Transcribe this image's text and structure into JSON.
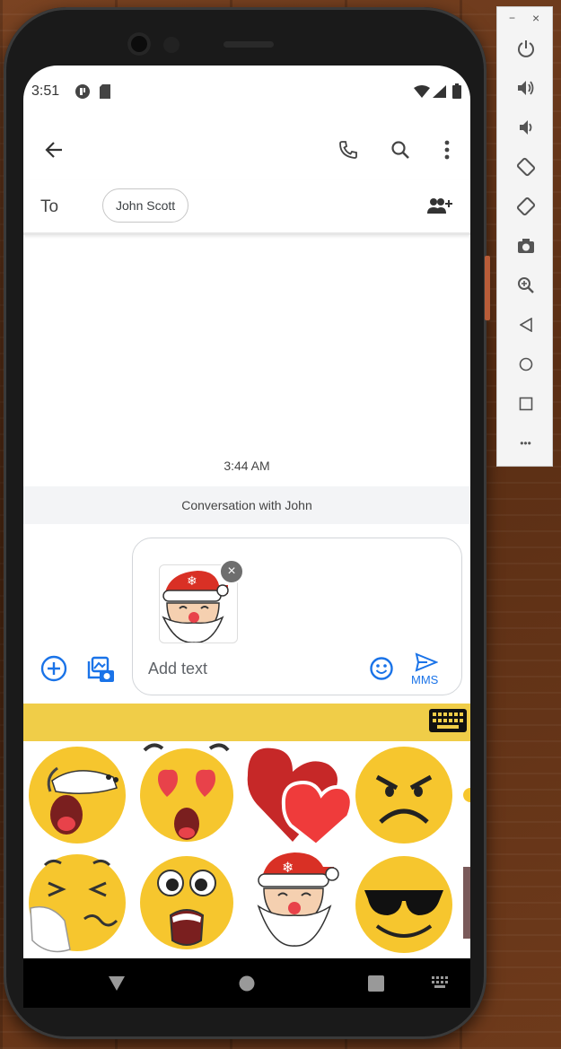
{
  "status_bar": {
    "time": "3:51",
    "left_icons": [
      "app-notification-icon",
      "sd-card-icon"
    ],
    "right_icons": [
      "wifi-icon",
      "signal-icon",
      "battery-icon"
    ]
  },
  "app_bar": {
    "icons": [
      "back-arrow-icon",
      "phone-icon",
      "search-icon",
      "more-vert-icon"
    ]
  },
  "recipients": {
    "to_label": "To",
    "chip": "John Scott",
    "add_icon": "add-person-icon"
  },
  "conversation": {
    "timestamp": "3:44 AM",
    "band_text": "Conversation with John"
  },
  "composer": {
    "placeholder": "Add text",
    "send_label": "MMS",
    "attachment_icon": "santa-sticker",
    "remove_glyph": "×",
    "left_icons": [
      "add-circle-icon",
      "gallery-camera-icon"
    ],
    "emoji_icon": "emoji-icon"
  },
  "sticker_keyboard": {
    "bar_icon": "keyboard-icon",
    "bar_color": "#f0cd48",
    "stickers": [
      "yawning-face",
      "heart-eyes-face",
      "red-hearts",
      "angry-face",
      "sneezing-face",
      "shocked-face",
      "santa-face",
      "sunglasses-face"
    ]
  },
  "nav_bar": {
    "buttons": [
      "back-triangle-icon",
      "home-circle-icon",
      "recents-square-icon",
      "keyboard-switch-icon"
    ]
  },
  "emulator_panel": {
    "minimize": "−",
    "close": "×",
    "items": [
      "power-icon",
      "volume-up-icon",
      "volume-down-icon",
      "rotate-left-icon",
      "rotate-right-icon",
      "camera-icon",
      "zoom-icon",
      "back-icon",
      "home-icon",
      "overview-icon",
      "more-icon"
    ],
    "more_glyph": "•••"
  },
  "colors": {
    "accent": "#1a73e8",
    "sticker_bar": "#f0cd48",
    "wood": "#6b3a1c"
  }
}
